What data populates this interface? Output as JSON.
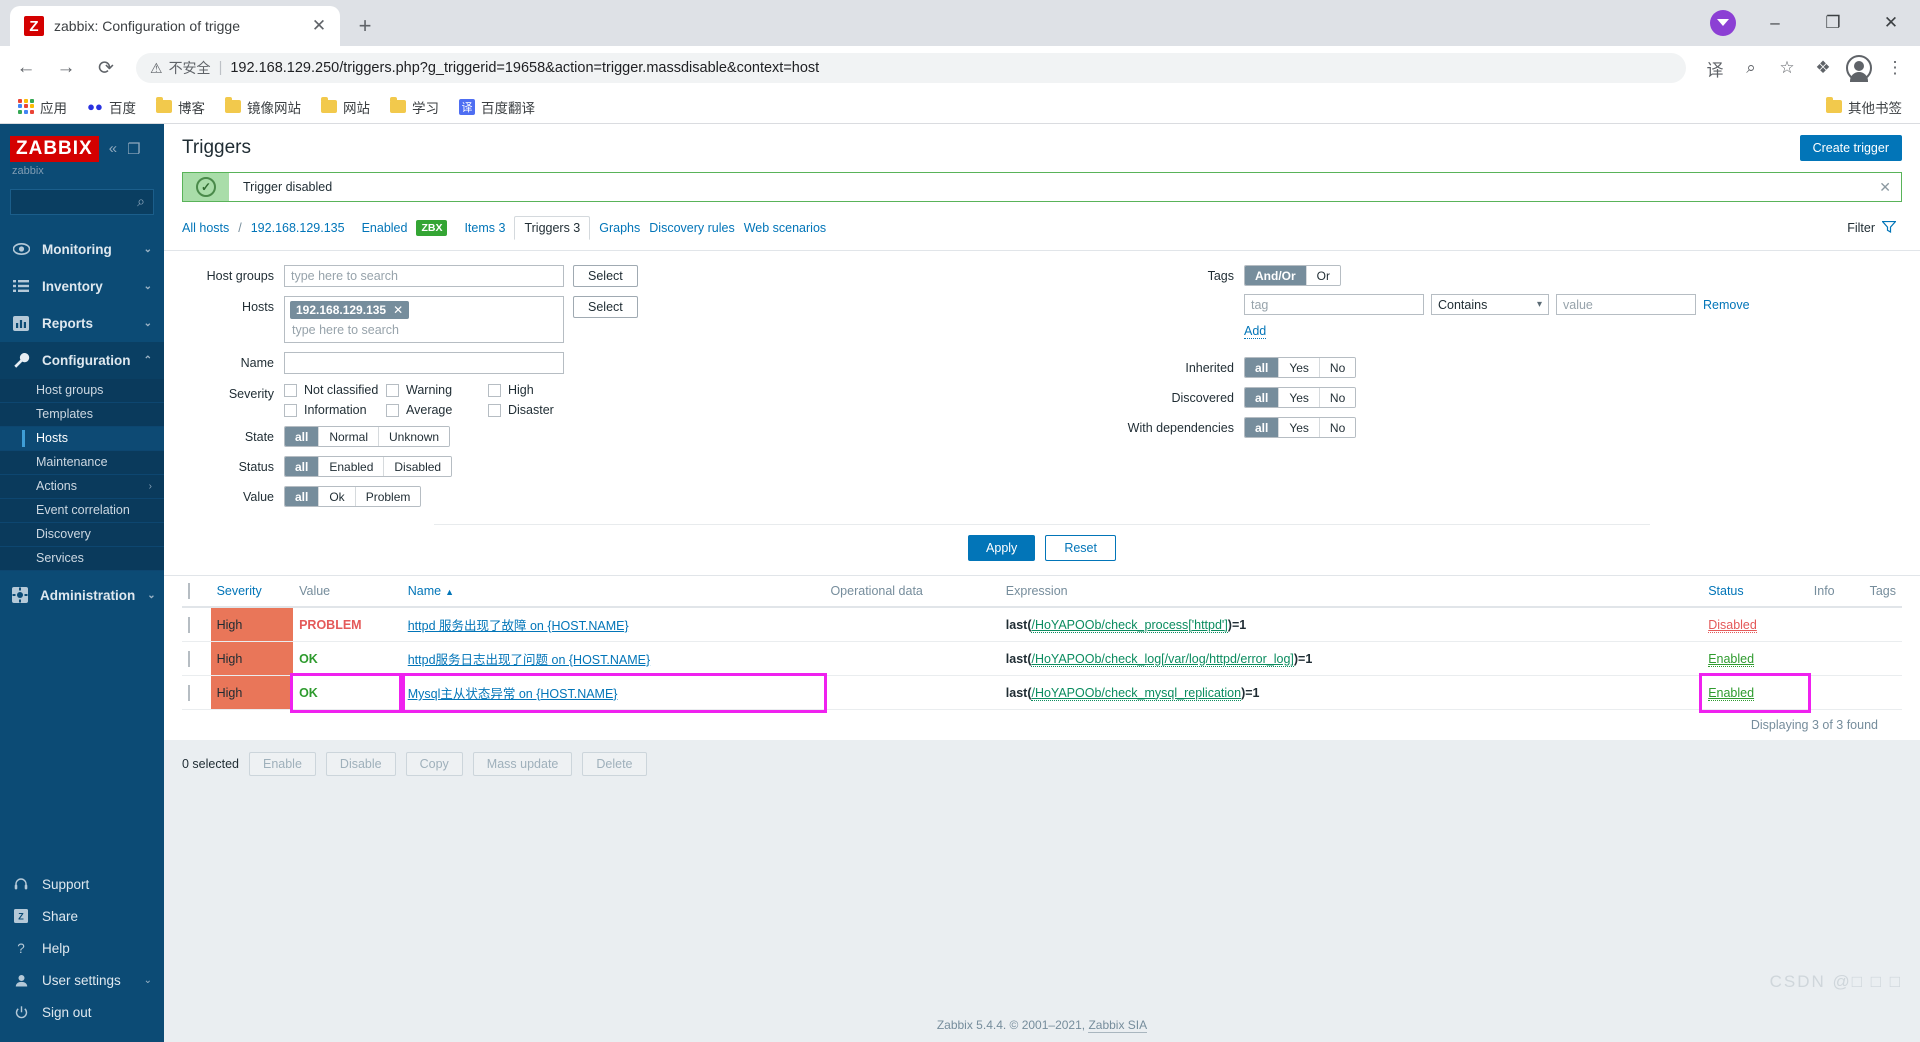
{
  "browser": {
    "tab": {
      "title": "zabbix: Configuration of trigge",
      "favicon_letter": "Z",
      "close_icon": "✕"
    },
    "newtab_icon": "+",
    "window_controls": {
      "minimize": "–",
      "maximize": "❐",
      "close": "✕"
    },
    "nav": {
      "back": "←",
      "forward": "→",
      "reload": "⟳"
    },
    "omnibox": {
      "warning_icon": "⚠",
      "warning_text": "不安全",
      "separator": "|",
      "url": "192.168.129.250/triggers.php?g_triggerid=19658&action=trigger.massdisable&context=host"
    },
    "nav_right": {
      "translate": "译",
      "zoom": "⌕",
      "bookmark_star": "☆",
      "extensions": "❖",
      "menu": "⋮"
    },
    "bookmarks": [
      {
        "label": "应用",
        "icon": "apps-grid"
      },
      {
        "label": "百度",
        "icon": "baidu"
      },
      {
        "label": "博客",
        "icon": "folder"
      },
      {
        "label": "镜像网站",
        "icon": "folder"
      },
      {
        "label": "网站",
        "icon": "folder"
      },
      {
        "label": "学习",
        "icon": "folder"
      },
      {
        "label": "百度翻译",
        "icon": "fanyi"
      }
    ],
    "bookmarks_right": {
      "label": "其他书签",
      "icon": "folder"
    }
  },
  "sidebar": {
    "logo": "ZABBIX",
    "logo_sub": "zabbix",
    "collapse_icon": "«",
    "popout_icon": "❐",
    "search_placeholder": "",
    "search_icon": "⌕",
    "nav": [
      {
        "label": "Monitoring",
        "icon": "eye",
        "caret": "⌄"
      },
      {
        "label": "Inventory",
        "icon": "list",
        "caret": "⌄"
      },
      {
        "label": "Reports",
        "icon": "chart",
        "caret": "⌄"
      },
      {
        "label": "Configuration",
        "icon": "wrench",
        "caret": "⌃",
        "active": true
      }
    ],
    "config_sub": [
      {
        "label": "Host groups"
      },
      {
        "label": "Templates"
      },
      {
        "label": "Hosts",
        "selected": true
      },
      {
        "label": "Maintenance"
      },
      {
        "label": "Actions",
        "arrow": "›"
      },
      {
        "label": "Event correlation"
      },
      {
        "label": "Discovery"
      },
      {
        "label": "Services"
      }
    ],
    "admin": {
      "label": "Administration",
      "icon": "gear",
      "caret": "⌄"
    },
    "bottom": [
      {
        "label": "Support",
        "icon": "headset"
      },
      {
        "label": "Share",
        "icon": "zabbix-z"
      },
      {
        "label": "Help",
        "icon": "question"
      },
      {
        "label": "User settings",
        "icon": "person",
        "caret": "⌄"
      },
      {
        "label": "Sign out",
        "icon": "power"
      }
    ]
  },
  "page": {
    "title": "Triggers",
    "create_button": "Create trigger",
    "message": {
      "text": "Trigger disabled",
      "check_icon": "✓",
      "close_icon": "✕"
    },
    "breadcrumb": {
      "all_hosts": "All hosts",
      "sep": "/",
      "host": "192.168.129.135",
      "enabled": "Enabled",
      "zbx_badge": "ZBX",
      "tabs": [
        {
          "label": "Items 3",
          "selected": false
        },
        {
          "label": "Triggers 3",
          "selected": true
        },
        {
          "label": "Graphs",
          "selected": false
        },
        {
          "label": "Discovery rules",
          "selected": false
        },
        {
          "label": "Web scenarios",
          "selected": false
        }
      ],
      "filter_label": "Filter",
      "filter_icon": "▼"
    }
  },
  "filter": {
    "host_groups": {
      "label": "Host groups",
      "placeholder": "type here to search",
      "value": "",
      "select_button": "Select"
    },
    "hosts": {
      "label": "Hosts",
      "chip": "192.168.129.135",
      "chip_remove": "✕",
      "placeholder": "type here to search",
      "select_button": "Select"
    },
    "name": {
      "label": "Name",
      "value": "",
      "placeholder": ""
    },
    "severity": {
      "label": "Severity",
      "options": [
        "Not classified",
        "Information",
        "Warning",
        "Average",
        "High",
        "Disaster"
      ]
    },
    "state": {
      "label": "State",
      "options": [
        "all",
        "Normal",
        "Unknown"
      ],
      "selected": "all"
    },
    "status": {
      "label": "Status",
      "options": [
        "all",
        "Enabled",
        "Disabled"
      ],
      "selected": "all"
    },
    "value": {
      "label": "Value",
      "options": [
        "all",
        "Ok",
        "Problem"
      ],
      "selected": "all"
    },
    "tags": {
      "label": "Tags",
      "logic_options": [
        "And/Or",
        "Or"
      ],
      "logic_selected": "And/Or",
      "tag_placeholder": "tag",
      "operator": "Contains",
      "value_placeholder": "value",
      "remove_label": "Remove",
      "add_label": "Add"
    },
    "inherited": {
      "label": "Inherited",
      "options": [
        "all",
        "Yes",
        "No"
      ],
      "selected": "all"
    },
    "discovered": {
      "label": "Discovered",
      "options": [
        "all",
        "Yes",
        "No"
      ],
      "selected": "all"
    },
    "with_dependencies": {
      "label": "With dependencies",
      "options": [
        "all",
        "Yes",
        "No"
      ],
      "selected": "all"
    },
    "apply_button": "Apply",
    "reset_button": "Reset"
  },
  "table": {
    "headers": {
      "severity": "Severity",
      "value": "Value",
      "name": "Name",
      "sort_arrow": "▲",
      "operational_data": "Operational data",
      "expression": "Expression",
      "status": "Status",
      "info": "Info",
      "tags": "Tags"
    },
    "rows": [
      {
        "severity": "High",
        "value": "PROBLEM",
        "value_state": "problem",
        "name": "httpd 服务出现了故障 on {HOST.NAME}",
        "operational_data": "",
        "expression_fn": "last(",
        "expression_ref": "/HoYAPOOb/check_process['httpd']",
        "expression_tail": ")=1",
        "status": "Disabled",
        "status_state": "disabled",
        "info": "",
        "tags": ""
      },
      {
        "severity": "High",
        "value": "OK",
        "value_state": "ok",
        "name": "httpd服务日志出现了问题 on {HOST.NAME}",
        "operational_data": "",
        "expression_fn": "last(",
        "expression_ref": "/HoYAPOOb/check_log[/var/log/httpd/error_log]",
        "expression_tail": ")=1",
        "status": "Enabled",
        "status_state": "enabled",
        "info": "",
        "tags": ""
      },
      {
        "severity": "High",
        "value": "OK",
        "value_state": "ok",
        "name": "Mysql主从状态异常 on {HOST.NAME}",
        "operational_data": "",
        "expression_fn": "last(",
        "expression_ref": "/HoYAPOOb/check_mysql_replication",
        "expression_tail": ")=1",
        "status": "Enabled",
        "status_state": "enabled",
        "info": "",
        "tags": "",
        "highlighted": true
      }
    ],
    "footer_count": "Displaying 3 of 3 found"
  },
  "actions": {
    "selected_text": "0 selected",
    "buttons": [
      "Enable",
      "Disable",
      "Copy",
      "Mass update",
      "Delete"
    ]
  },
  "footer": {
    "text": "Zabbix 5.4.4. © 2001–2021, ",
    "link": "Zabbix SIA",
    "watermark": "CSDN @□ □ □"
  },
  "colors": {
    "brand_red": "#d40000",
    "sidebar_blue": "#0c4b75",
    "accent_blue": "#0275b8",
    "severity_high": "#e97659",
    "problem_red": "#e45959",
    "ok_green": "#2e9b2e",
    "highlight_magenta": "#ef21ef"
  }
}
